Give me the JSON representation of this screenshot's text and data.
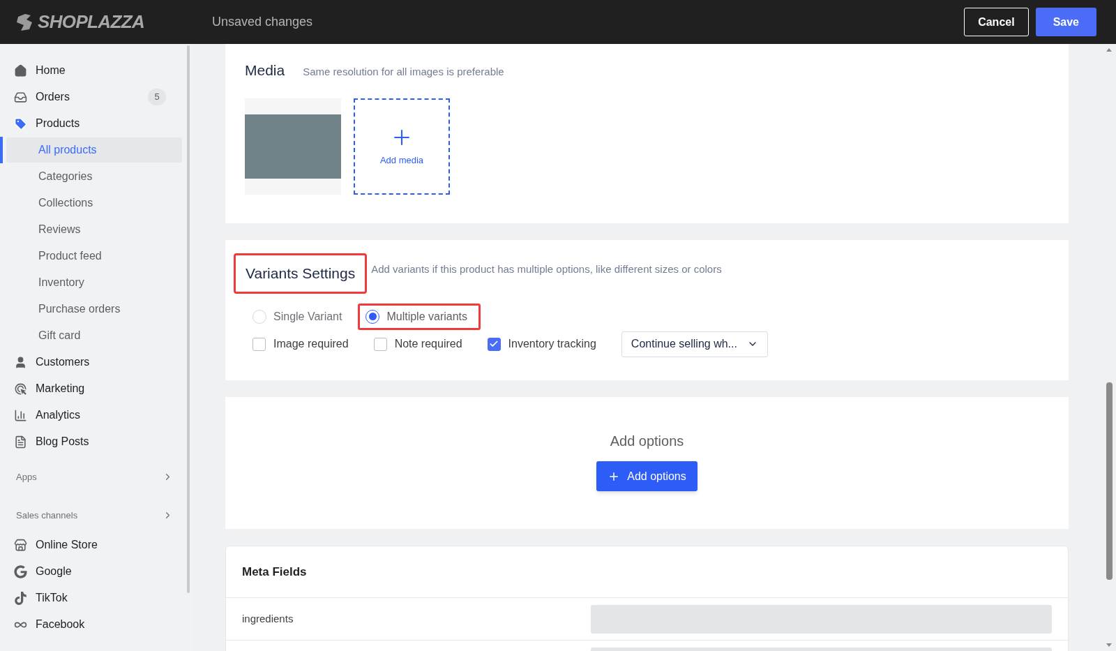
{
  "header": {
    "logo": "SHOPLAZZA",
    "status": "Unsaved changes",
    "buttons": [
      {
        "label": "Cancel",
        "kind": "outline"
      },
      {
        "label": "Save",
        "kind": "primary"
      }
    ]
  },
  "sidebar": {
    "groups": [
      {
        "items": [
          {
            "label": "Home",
            "kind": "home",
            "selected": false
          },
          {
            "label": "Orders",
            "kind": "orders",
            "badge": "5",
            "selected": false
          },
          {
            "label": "Products",
            "kind": "tag",
            "selected": true,
            "children": [
              {
                "label": "All products",
                "selected": true
              },
              {
                "label": "Categories",
                "selected": false
              },
              {
                "label": "Collections",
                "selected": false
              },
              {
                "label": "Reviews",
                "selected": false
              },
              {
                "label": "Product feed",
                "selected": false
              },
              {
                "label": "Inventory",
                "selected": false
              },
              {
                "label": "Purchase orders",
                "selected": false
              },
              {
                "label": "Gift card",
                "selected": false
              }
            ]
          },
          {
            "label": "Customers",
            "kind": "user",
            "selected": false
          },
          {
            "label": "Marketing",
            "kind": "marketing",
            "selected": false
          },
          {
            "label": "Analytics",
            "kind": "chart",
            "selected": false
          },
          {
            "label": "Blog Posts",
            "kind": "blog",
            "selected": false
          }
        ]
      },
      {
        "title": "Apps"
      },
      {
        "title": "Sales channels",
        "items": [
          {
            "label": "Online Store",
            "kind": "store",
            "selected": false
          },
          {
            "label": "Google",
            "kind": "google",
            "selected": false
          },
          {
            "label": "TikTok",
            "kind": "tiktok",
            "selected": false
          },
          {
            "label": "Facebook",
            "kind": "meta",
            "selected": false
          }
        ]
      }
    ]
  },
  "media": {
    "title": "Media",
    "hint": "Same resolution for all images is preferable",
    "add_label": "Add media"
  },
  "variants": {
    "title": "Variants Settings",
    "hint": "Add variants if this product has multiple options, like different sizes or colors",
    "radios": [
      {
        "label": "Single Variant",
        "selected": false,
        "highlighted": false
      },
      {
        "label": "Multiple variants",
        "selected": true,
        "highlighted": true
      }
    ],
    "checkboxes": [
      {
        "label": "Image required",
        "checked": false
      },
      {
        "label": "Note required",
        "checked": false
      },
      {
        "label": "Inventory tracking",
        "checked": true
      }
    ],
    "select": {
      "value": "Continue selling wh..."
    }
  },
  "options": {
    "title": "Add options",
    "button": "Add options"
  },
  "meta_fields": {
    "title": "Meta Fields",
    "rows": [
      {
        "label": "ingredients"
      },
      {}
    ]
  }
}
